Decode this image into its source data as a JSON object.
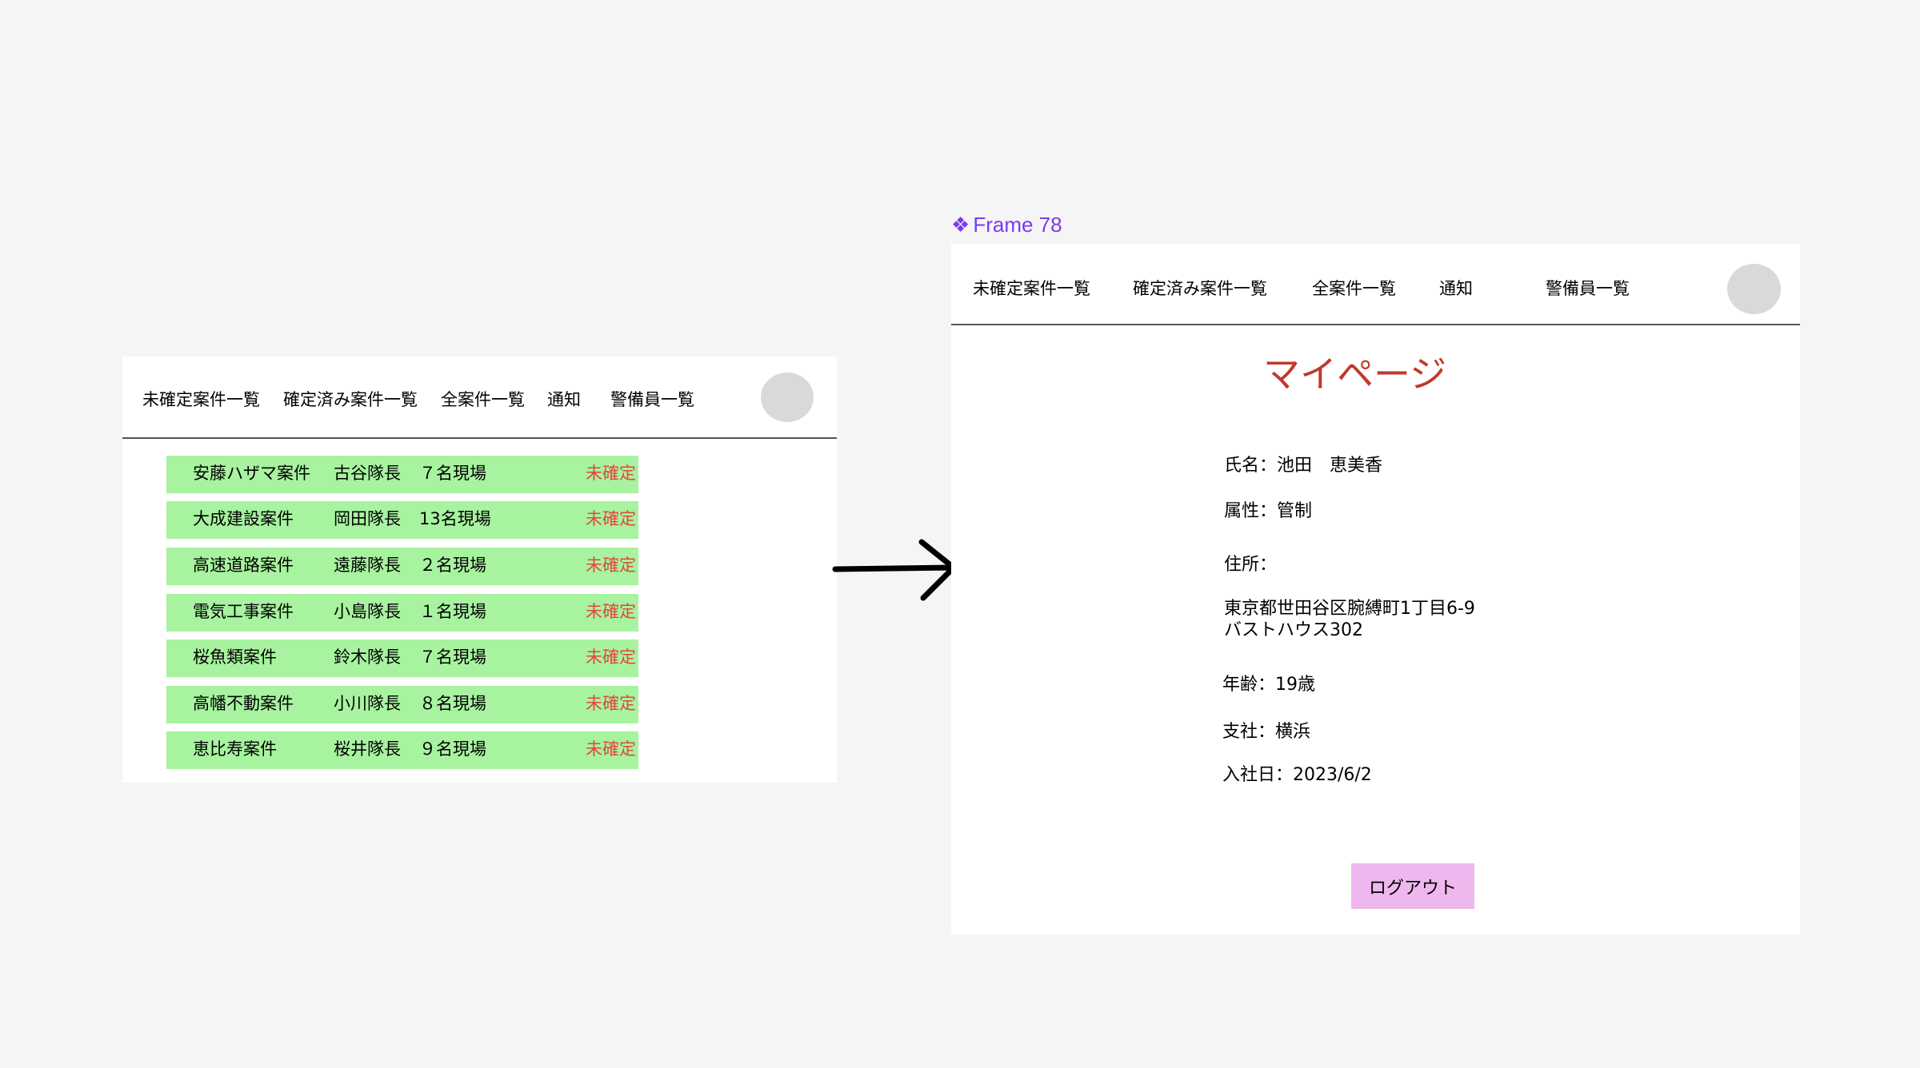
{
  "nav": {
    "unconfirmed": "未確定案件一覧",
    "confirmed": "確定済み案件一覧",
    "all": "全案件一覧",
    "notifications": "通知",
    "guards": "警備員一覧"
  },
  "cases": [
    {
      "name": "安藤ハザマ案件",
      "leader": "古谷隊長",
      "count": "７名現場",
      "status": "未確定"
    },
    {
      "name": "大成建設案件",
      "leader": "岡田隊長",
      "count": "13名現場",
      "status": "未確定"
    },
    {
      "name": "高速道路案件",
      "leader": "遠藤隊長",
      "count": "２名現場",
      "status": "未確定"
    },
    {
      "name": "電気工事案件",
      "leader": "小島隊長",
      "count": "１名現場",
      "status": "未確定"
    },
    {
      "name": "桜魚類案件",
      "leader": "鈴木隊長",
      "count": "７名現場",
      "status": "未確定"
    },
    {
      "name": "高幡不動案件",
      "leader": "小川隊長",
      "count": "８名現場",
      "status": "未確定"
    },
    {
      "name": "恵比寿案件",
      "leader": "桜井隊長",
      "count": "９名現場",
      "status": "未確定"
    }
  ],
  "frame_label": {
    "icon": "component-diamond-icon",
    "symbol": "❖",
    "text": "Frame 78"
  },
  "mypage": {
    "title": "マイページ",
    "name": "氏名：池田　恵美香",
    "attribute": "属性：管制",
    "address_label": "住所：",
    "address_line1": "東京都世田谷区腕縛町1丁目6-9",
    "address_line2": "バストハウス302",
    "age": "年齢：19歳",
    "branch": "支社：横浜",
    "join_date": "入社日：2023/6/2",
    "logout_label": "ログアウト"
  },
  "colors": {
    "row_bg": "#a7f39f",
    "status_text": "#e2473a",
    "title_text": "#c0392b",
    "logout_bg": "#eeb8ee",
    "frame_label": "#7c3aed",
    "avatar": "#d9d9d9"
  }
}
